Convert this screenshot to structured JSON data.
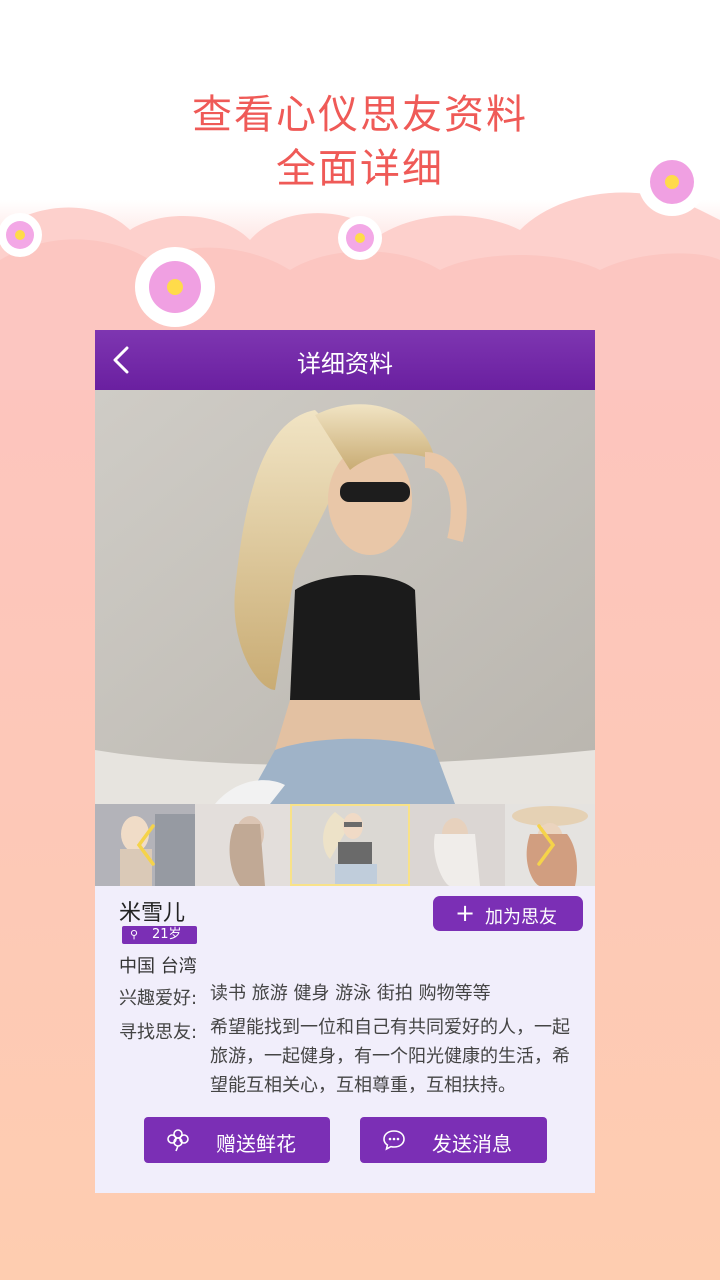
{
  "headline": {
    "line1": "查看心仪思友资料",
    "line2": "全面详细"
  },
  "nav": {
    "title": "详细资料",
    "back_icon": "chevron-left-icon"
  },
  "profile": {
    "name": "米雪儿",
    "age": "21岁",
    "location": "中国 台湾",
    "add_button": "加为思友",
    "interests_label": "兴趣爱好:",
    "interests": "读书 旅游 健身 游泳 街拍 购物等等",
    "seeking_label": "寻找思友:",
    "seeking": "希望能找到一位和自己有共同爱好的人，一起旅游，一起健身，有一个阳光健康的生活，希望能互相关心，互相尊重，互相扶持。"
  },
  "gallery": {
    "photos": 5,
    "selected_index": 3
  },
  "actions": {
    "flower_label": "赠送鲜花",
    "message_label": "发送消息"
  },
  "colors": {
    "accent": "#7b2fb5",
    "headline": "#ef5a57",
    "arrow": "#f5d34a"
  }
}
